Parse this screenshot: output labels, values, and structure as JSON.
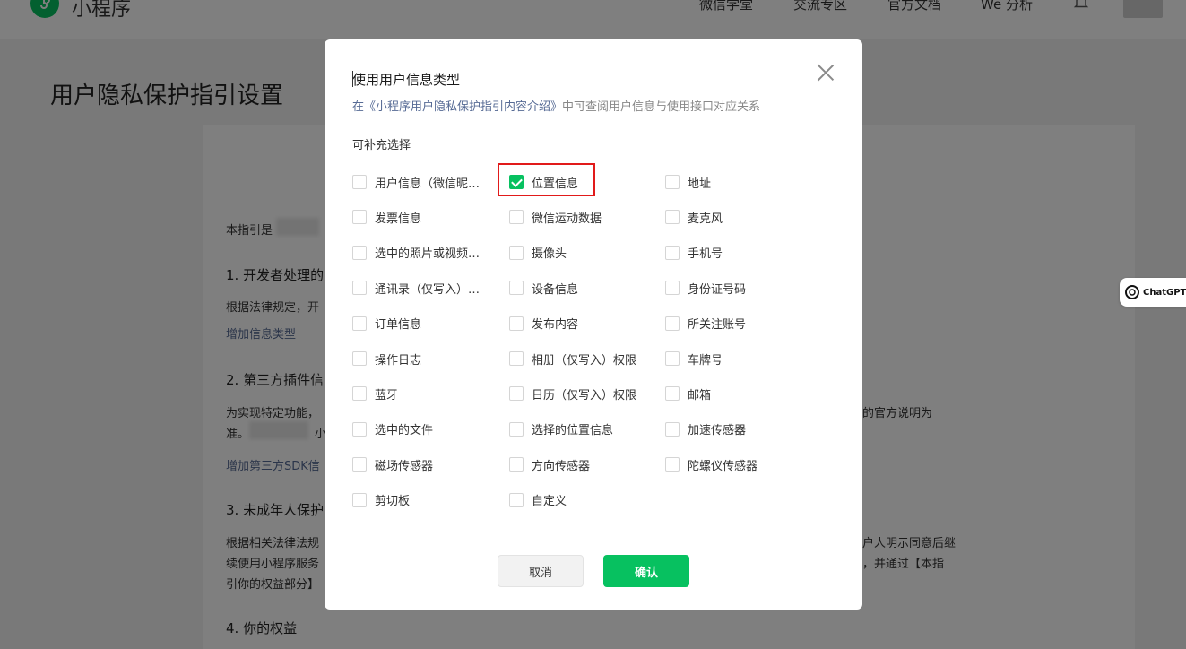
{
  "header": {
    "brand": "小程序",
    "nav": [
      "微信学堂",
      "交流专区",
      "官方文档",
      "We 分析"
    ]
  },
  "page": {
    "title": "用户隐私保护指引设置",
    "lines": {
      "intro": "本指引是",
      "s1_heading": "1. 开发者处理的",
      "s1_text": "根据法律规定，开",
      "s1_link": "增加信息类型",
      "s2_heading": "2. 第三方插件信",
      "s2_text": "为实现特定功能，",
      "s2_text_right": "的官方说明为",
      "s2_text2": "准。",
      "s2_text2_b": "小",
      "s2_link": "增加第三方SDK信",
      "s3_heading": "3. 未成年人保护",
      "s3_text": "根据相关法律法规",
      "s3_text_right": "户人明示同意后继",
      "s3_text2": "续使用小程序服务",
      "s3_text2_right": "，并通过【本指",
      "s3_text3": "引你的权益部分】",
      "s4_heading": "4. 你的权益"
    }
  },
  "badge": {
    "label": "ChatGPT"
  },
  "dialog": {
    "title": "使用用户信息类型",
    "subtitle_link": "在《小程序用户隐私保护指引内容介绍》",
    "subtitle_rest": "中可查阅用户信息与使用接口对应关系",
    "section": "可补充选择",
    "options": [
      {
        "label": "用户信息（微信昵称、头像）",
        "checked": false
      },
      {
        "label": "位置信息",
        "checked": true
      },
      {
        "label": "地址",
        "checked": false
      },
      {
        "label": "发票信息",
        "checked": false
      },
      {
        "label": "微信运动数据",
        "checked": false
      },
      {
        "label": "麦克风",
        "checked": false
      },
      {
        "label": "选中的照片或视频信息",
        "checked": false
      },
      {
        "label": "摄像头",
        "checked": false
      },
      {
        "label": "手机号",
        "checked": false
      },
      {
        "label": "通讯录（仅写入）权限",
        "checked": false
      },
      {
        "label": "设备信息",
        "checked": false
      },
      {
        "label": "身份证号码",
        "checked": false
      },
      {
        "label": "订单信息",
        "checked": false
      },
      {
        "label": "发布内容",
        "checked": false
      },
      {
        "label": "所关注账号",
        "checked": false
      },
      {
        "label": "操作日志",
        "checked": false
      },
      {
        "label": "相册（仅写入）权限",
        "checked": false
      },
      {
        "label": "车牌号",
        "checked": false
      },
      {
        "label": "蓝牙",
        "checked": false
      },
      {
        "label": "日历（仅写入）权限",
        "checked": false
      },
      {
        "label": "邮箱",
        "checked": false
      },
      {
        "label": "选中的文件",
        "checked": false
      },
      {
        "label": "选择的位置信息",
        "checked": false
      },
      {
        "label": "加速传感器",
        "checked": false
      },
      {
        "label": "磁场传感器",
        "checked": false
      },
      {
        "label": "方向传感器",
        "checked": false
      },
      {
        "label": "陀螺仪传感器",
        "checked": false
      },
      {
        "label": "剪切板",
        "checked": false
      },
      {
        "label": "自定义",
        "checked": false
      }
    ],
    "cancel_label": "取消",
    "confirm_label": "确认"
  },
  "colors": {
    "brand_green": "#07c160",
    "link_blue": "#576b95",
    "highlight_red": "#e11a1a"
  }
}
